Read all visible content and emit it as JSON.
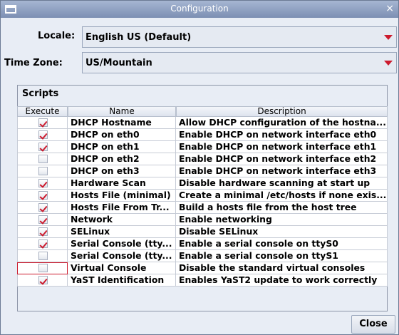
{
  "window": {
    "title": "Configuration",
    "close_glyph": "×",
    "icon": "window-icon"
  },
  "locale": {
    "label": "Locale:",
    "value": "English US (Default)"
  },
  "timezone": {
    "label": "Time Zone:",
    "value": "US/Mountain"
  },
  "scripts": {
    "title": "Scripts",
    "columns": [
      "Execute",
      "Name",
      "Description"
    ],
    "rows": [
      {
        "checked": true,
        "name": "DHCP Hostname",
        "description": "Allow DHCP configuration of the hostna..."
      },
      {
        "checked": true,
        "name": "DHCP on eth0",
        "description": "Enable DHCP on network interface eth0"
      },
      {
        "checked": true,
        "name": "DHCP on eth1",
        "description": "Enable DHCP on network interface eth1"
      },
      {
        "checked": false,
        "name": "DHCP on eth2",
        "description": "Enable DHCP on network interface eth2"
      },
      {
        "checked": false,
        "name": "DHCP on eth3",
        "description": "Enable DHCP on network interface eth3"
      },
      {
        "checked": true,
        "name": "Hardware Scan",
        "description": "Disable hardware scanning at start up"
      },
      {
        "checked": true,
        "name": "Hosts File (minimal)",
        "description": "Create a minimal /etc/hosts if none exis..."
      },
      {
        "checked": true,
        "name": "Hosts File From Tr...",
        "description": "Build a hosts file from the host tree"
      },
      {
        "checked": true,
        "name": "Network",
        "description": "Enable networking"
      },
      {
        "checked": true,
        "name": "SELinux",
        "description": "Disable SELinux"
      },
      {
        "checked": true,
        "name": "Serial Console (tty...",
        "description": "Enable a serial console on ttyS0"
      },
      {
        "checked": false,
        "name": "Serial Console (tty...",
        "description": "Enable a serial console on ttyS1"
      },
      {
        "checked": false,
        "name": "Virtual Console",
        "description": "Disable the standard virtual consoles",
        "focused": true
      },
      {
        "checked": true,
        "name": "YaST Identification",
        "description": "Enables YaST2 update to work correctly"
      }
    ]
  },
  "buttons": {
    "close_label": "Close"
  },
  "colors": {
    "accent": "#cc1b2e",
    "titlebar": "#8a9cbd"
  }
}
